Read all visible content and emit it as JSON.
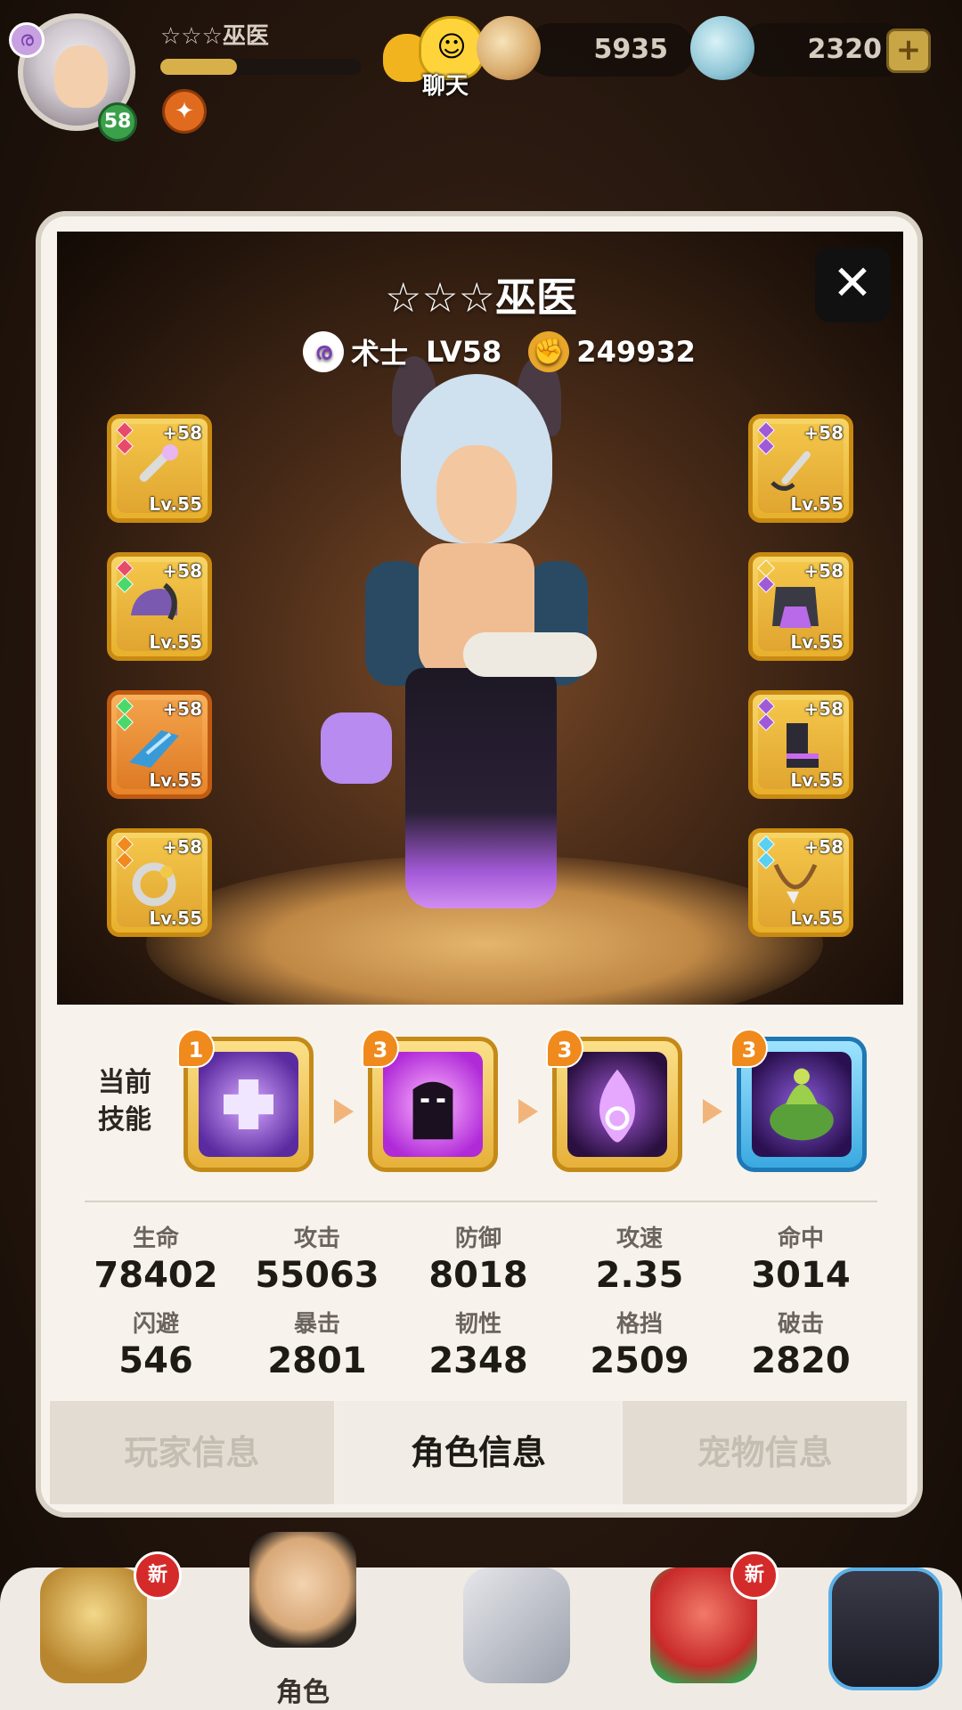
{
  "hud": {
    "player_name": "☆☆☆巫医",
    "player_level": "58",
    "xp_progress": 0.38,
    "chat_label": "聊天",
    "gold": "5935",
    "gems": "2320",
    "add_label": "+"
  },
  "character": {
    "title": "☆☆☆巫医",
    "class_name": "术士",
    "level": "LV58",
    "power": "249932",
    "close_label": "✕"
  },
  "equipment": {
    "left": [
      {
        "plus": "+58",
        "level": "Lv.55",
        "icon": "staff-icon"
      },
      {
        "plus": "+58",
        "level": "Lv.55",
        "icon": "helmet-icon"
      },
      {
        "plus": "+58",
        "level": "Lv.55",
        "icon": "bracer-icon"
      },
      {
        "plus": "+58",
        "level": "Lv.55",
        "icon": "ring-icon"
      }
    ],
    "right": [
      {
        "plus": "+58",
        "level": "Lv.55",
        "icon": "wand-icon"
      },
      {
        "plus": "+58",
        "level": "Lv.55",
        "icon": "armor-icon"
      },
      {
        "plus": "+58",
        "level": "Lv.55",
        "icon": "boots-icon"
      },
      {
        "plus": "+58",
        "level": "Lv.55",
        "icon": "necklace-icon"
      }
    ]
  },
  "skills": {
    "label_line1": "当前",
    "label_line2": "技能",
    "items": [
      {
        "badge": "1",
        "icon": "heal-cross-icon"
      },
      {
        "badge": "3",
        "icon": "shadow-figure-icon"
      },
      {
        "badge": "3",
        "icon": "spirit-flame-icon"
      },
      {
        "badge": "3",
        "icon": "toad-totem-icon"
      }
    ]
  },
  "stats": [
    {
      "label": "生命",
      "value": "78402"
    },
    {
      "label": "攻击",
      "value": "55063"
    },
    {
      "label": "防御",
      "value": "8018"
    },
    {
      "label": "攻速",
      "value": "2.35"
    },
    {
      "label": "命中",
      "value": "3014"
    },
    {
      "label": "闪避",
      "value": "546"
    },
    {
      "label": "暴击",
      "value": "2801"
    },
    {
      "label": "韧性",
      "value": "2348"
    },
    {
      "label": "格挡",
      "value": "2509"
    },
    {
      "label": "破击",
      "value": "2820"
    }
  ],
  "tabs": [
    {
      "label": "玩家信息"
    },
    {
      "label": "角色信息"
    },
    {
      "label": "宠物信息"
    }
  ],
  "nav": {
    "role_label": "角色",
    "new_badge": "新"
  },
  "colors": {
    "accent_gold": "#e8b12c",
    "panel": "#f7f3ec",
    "active_tab_text": "#1e1a16"
  }
}
